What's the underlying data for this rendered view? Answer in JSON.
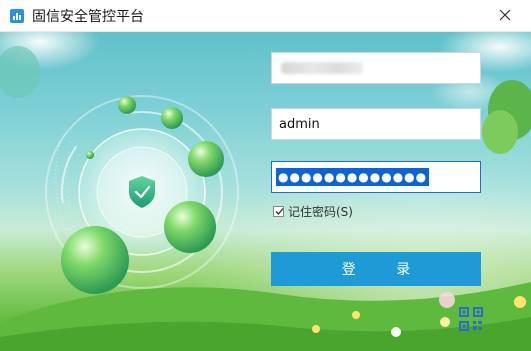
{
  "window": {
    "title": "固信安全管控平台"
  },
  "form": {
    "server_value": "",
    "username_value": "admin",
    "password_mask": "●●●●●●●●●●●●●",
    "remember_label": "记住密码(S)",
    "remember_checked": true,
    "login_label": "登 录"
  },
  "icons": {
    "app": "app-logo-icon",
    "close": "close-icon",
    "shield": "shield-check-icon",
    "qr": "qr-code-icon"
  },
  "colors": {
    "accent": "#1e9ad6",
    "selection": "#0a64d8",
    "icon_blue": "#2b8ee8"
  }
}
